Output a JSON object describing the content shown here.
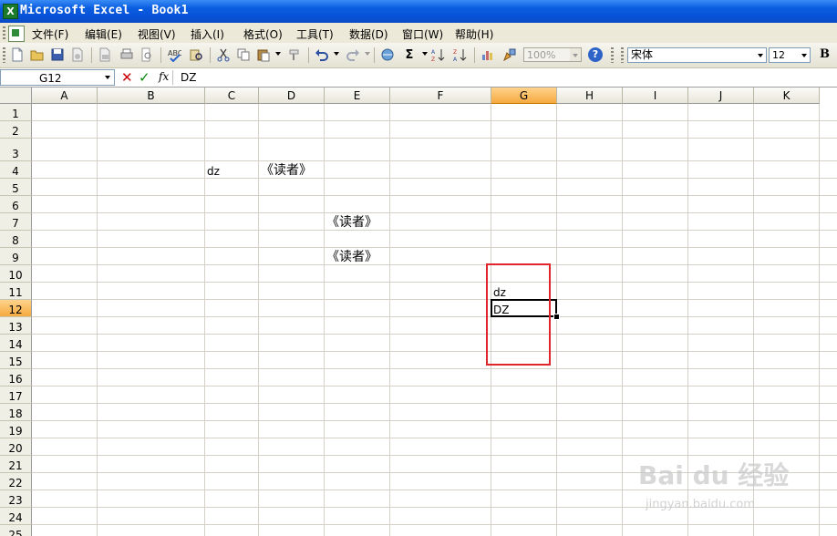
{
  "window": {
    "title": "Microsoft Excel - Book1",
    "app_icon": "excel-icon"
  },
  "menu": {
    "items": [
      {
        "label": "文件(F)"
      },
      {
        "label": "编辑(E)"
      },
      {
        "label": "视图(V)"
      },
      {
        "label": "插入(I)"
      },
      {
        "label": "格式(O)"
      },
      {
        "label": "工具(T)"
      },
      {
        "label": "数据(D)"
      },
      {
        "label": "窗口(W)"
      },
      {
        "label": "帮助(H)"
      }
    ]
  },
  "toolbar": {
    "zoom": "100%",
    "help_label": "?",
    "sum_label": "Σ",
    "font_name": "宋体",
    "font_size": "12",
    "bold_label": "B",
    "icons": [
      "new-icon",
      "open-icon",
      "save-icon",
      "permission-icon",
      "print-icon",
      "print-preview-icon",
      "spelling-icon",
      "research-icon",
      "cut-icon",
      "copy-icon",
      "paste-icon",
      "format-painter-icon",
      "undo-icon",
      "redo-icon",
      "hyperlink-icon",
      "autosum-icon",
      "sort-ascending-icon",
      "sort-descending-icon",
      "chart-wizard-icon",
      "drawing-icon",
      "help-icon"
    ]
  },
  "formula_bar": {
    "name_box": "G12",
    "cancel_symbol": "✕",
    "enter_symbol": "✓",
    "fx_label": "fx",
    "value": "DZ"
  },
  "sheet": {
    "columns": [
      "A",
      "B",
      "C",
      "D",
      "E",
      "F",
      "G",
      "H",
      "I",
      "J",
      "K"
    ],
    "rows": [
      "1",
      "2",
      "3",
      "4",
      "5",
      "6",
      "7",
      "8",
      "9",
      "10",
      "11",
      "12",
      "13",
      "14",
      "15",
      "16",
      "17",
      "18",
      "19",
      "20",
      "21",
      "22",
      "23",
      "24",
      "25"
    ],
    "active_cell": "G12",
    "active_column": "G",
    "active_row": "12",
    "cells": {
      "C4": "dz",
      "D4": "《读者》",
      "E7": "《读者》",
      "E9": "《读者》",
      "G11": "dz",
      "G12": "DZ"
    },
    "annotation_color": "#e0262b"
  },
  "watermark": {
    "text": "Bai du 经验",
    "sub": "jingyan.baidu.com"
  }
}
